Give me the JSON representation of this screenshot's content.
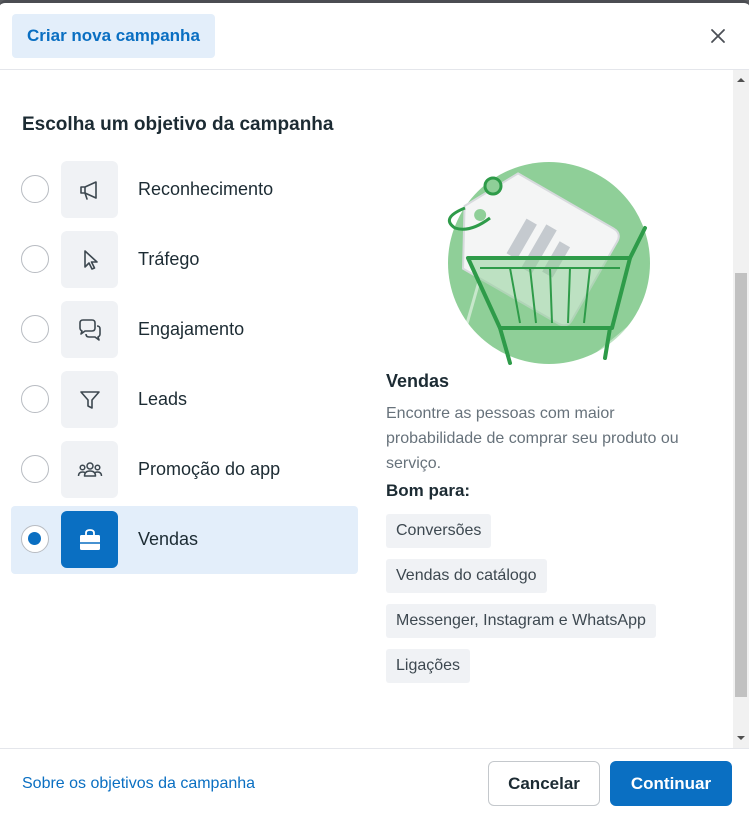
{
  "header": {
    "title": "Criar nova campanha",
    "close_icon": "close-icon"
  },
  "main": {
    "section_title": "Escolha um objetivo da campanha",
    "objectives": [
      {
        "label": "Reconhecimento",
        "icon": "megaphone-icon",
        "selected": false
      },
      {
        "label": "Tráfego",
        "icon": "cursor-icon",
        "selected": false
      },
      {
        "label": "Engajamento",
        "icon": "chat-bubbles-icon",
        "selected": false
      },
      {
        "label": "Leads",
        "icon": "funnel-icon",
        "selected": false
      },
      {
        "label": "Promoção do app",
        "icon": "people-group-icon",
        "selected": false
      },
      {
        "label": "Vendas",
        "icon": "shopping-bag-icon",
        "selected": true
      }
    ],
    "detail": {
      "title": "Vendas",
      "description": "Encontre as pessoas com maior probabilidade de comprar seu produto ou serviço.",
      "good_for_label": "Bom para:",
      "tags": [
        "Conversões",
        "Vendas do catálogo",
        "Messenger, Instagram e WhatsApp",
        "Ligações"
      ]
    }
  },
  "footer": {
    "link": "Sobre os objetivos da campanha",
    "cancel_label": "Cancelar",
    "continue_label": "Continuar"
  },
  "colors": {
    "accent": "#0a6fc2",
    "selected_bg": "#e3eefa",
    "illustration_green": "#8fcf98"
  }
}
